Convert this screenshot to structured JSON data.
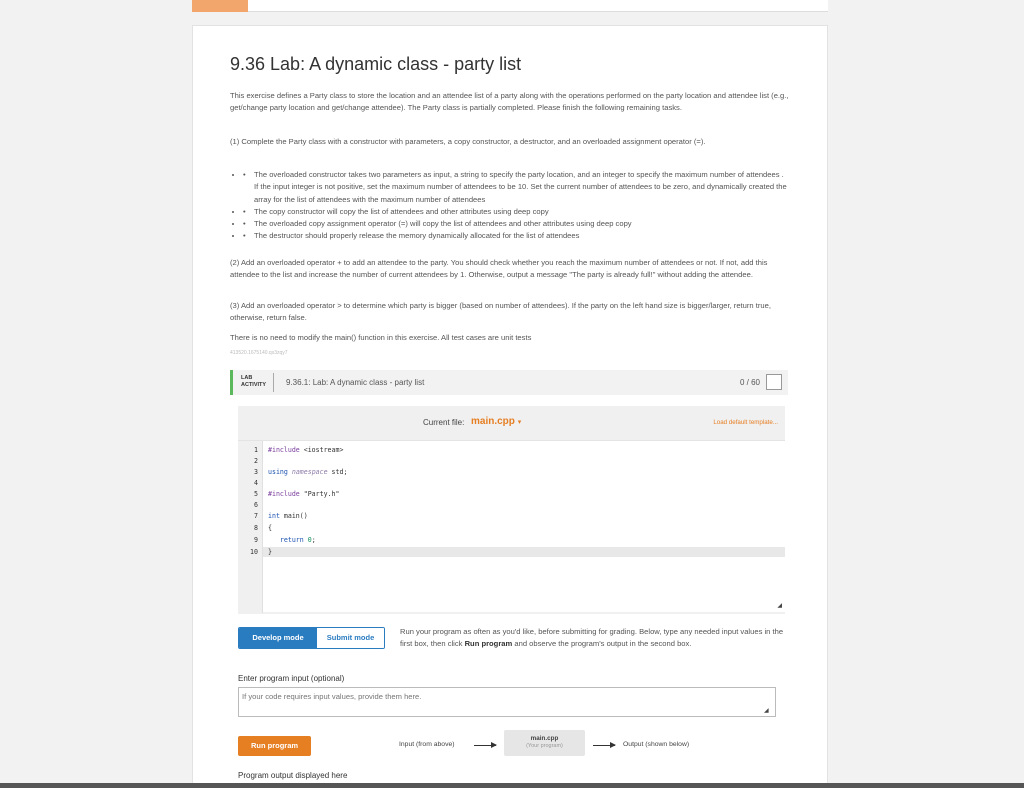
{
  "page": {
    "title": "9.36 Lab: A dynamic class - party list",
    "intro": "This exercise defines a Party class to store the location and an attendee list of a party along with the operations performed on the party location and attendee list (e.g., get/change party location and get/change attendee). The Party class is partially completed. Please finish the following remaining tasks.",
    "task1": "(1) Complete the Party class with a constructor with parameters, a copy constructor, a destructor, and an overloaded assignment operator (=).",
    "bullets": [
      "The overloaded constructor takes two parameters as input, a string to specify the party location, and an integer to specify the maximum number of attendees . If the input integer is not positive, set the maximum number of attendees to be 10. Set the current number of attendees to be zero, and dynamically created the array for the list of attendees with the maximum number of attendees",
      "The copy constructor will copy the list of attendees and other attributes using deep copy",
      "The overloaded copy assignment operator (=) will copy the list of attendees and other attributes using deep copy",
      "The destructor should properly release the memory dynamically allocated for the list of attendees"
    ],
    "task2": "(2) Add an overloaded operator + to add an attendee to the party. You should check whether you reach the maximum number of attendees or not. If not, add this attendee to the list and increase the number of current attendees by 1. Otherwise, output a message \"The party is already full!\" without adding the attendee.",
    "task3": "(3) Add an overloaded operator > to determine which party is bigger (based on number of attendees). If the party on the left hand size is bigger/larger, return true, otherwise, return false.",
    "note": "There is no need to modify the main() function in this exercise. All test cases are unit tests",
    "tiny_id": "413520.1675140.qx3zqy7"
  },
  "lab": {
    "tag_line1": "LAB",
    "tag_line2": "ACTIVITY",
    "title": "9.36.1: Lab: A dynamic class - party list",
    "score": "0 / 60"
  },
  "editor": {
    "current_file_label": "Current file:",
    "current_file": "main.cpp",
    "load_default": "Load default template...",
    "line_numbers": [
      "1",
      "2",
      "3",
      "4",
      "5",
      "6",
      "7",
      "8",
      "9",
      "10"
    ]
  },
  "modes": {
    "develop": "Develop mode",
    "submit": "Submit mode",
    "desc_before": "Run your program as often as you'd like, before submitting for grading. Below, type any needed input values in the first box, then click ",
    "desc_bold": "Run program",
    "desc_after": " and observe the program's output in the second box."
  },
  "input": {
    "label": "Enter program input (optional)",
    "placeholder": "If your code requires input values, provide them here."
  },
  "run": {
    "button": "Run program",
    "flow_input": "Input (from above)",
    "flow_program": "main.cpp",
    "flow_program_sub": "(Your program)",
    "flow_output": "Output (shown below)"
  },
  "output": {
    "label": "Program output displayed here"
  }
}
